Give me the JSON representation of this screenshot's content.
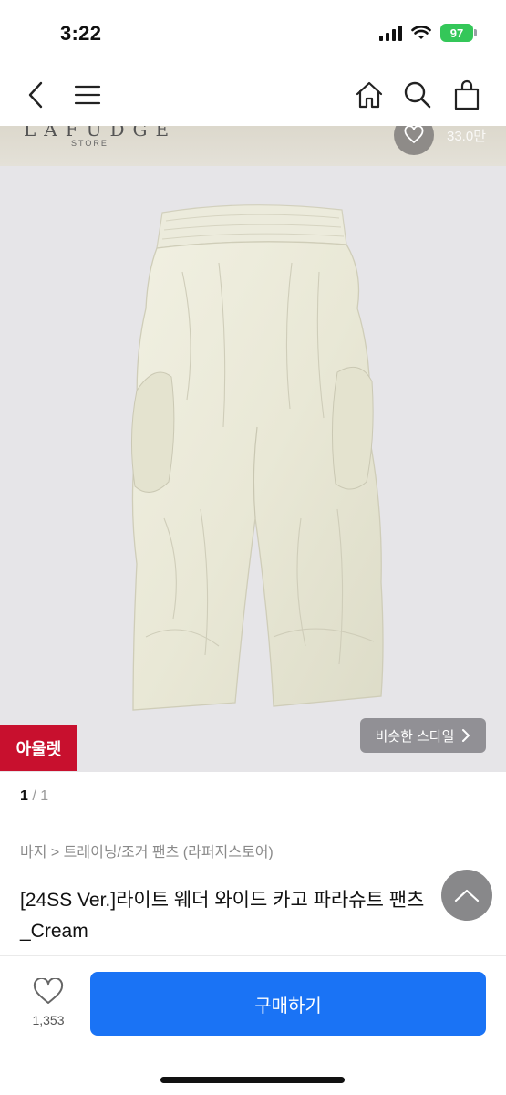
{
  "status": {
    "time": "3:22",
    "battery": "97"
  },
  "nav": {
    "back_icon": "chevron-left-icon",
    "menu_icon": "hamburger-menu-icon",
    "home_icon": "home-icon",
    "search_icon": "search-icon",
    "bag_icon": "shopping-bag-icon"
  },
  "hero": {
    "brand": "LAFUDGE",
    "brand_sub": "STORE",
    "price": "33.0만",
    "outlet_badge": "아울렛",
    "similar_style": "비슷한 스타일",
    "image_colors": {
      "background": "#e6e5e8",
      "garment": "#ecebd9"
    }
  },
  "pager": {
    "current": "1",
    "total": "/ 1"
  },
  "breadcrumb": "바지 > 트레이닝/조거 팬츠 (라퍼지스토어)",
  "product": {
    "title": "[24SS Ver.]라이트 웨더 와이드 카고 파라슈트 팬츠_Cream"
  },
  "bottom": {
    "wish_count": "1,353",
    "buy_label": "구매하기",
    "buy_color": "#1a73f5"
  },
  "colors": {
    "outlet_red": "#c8102e"
  }
}
